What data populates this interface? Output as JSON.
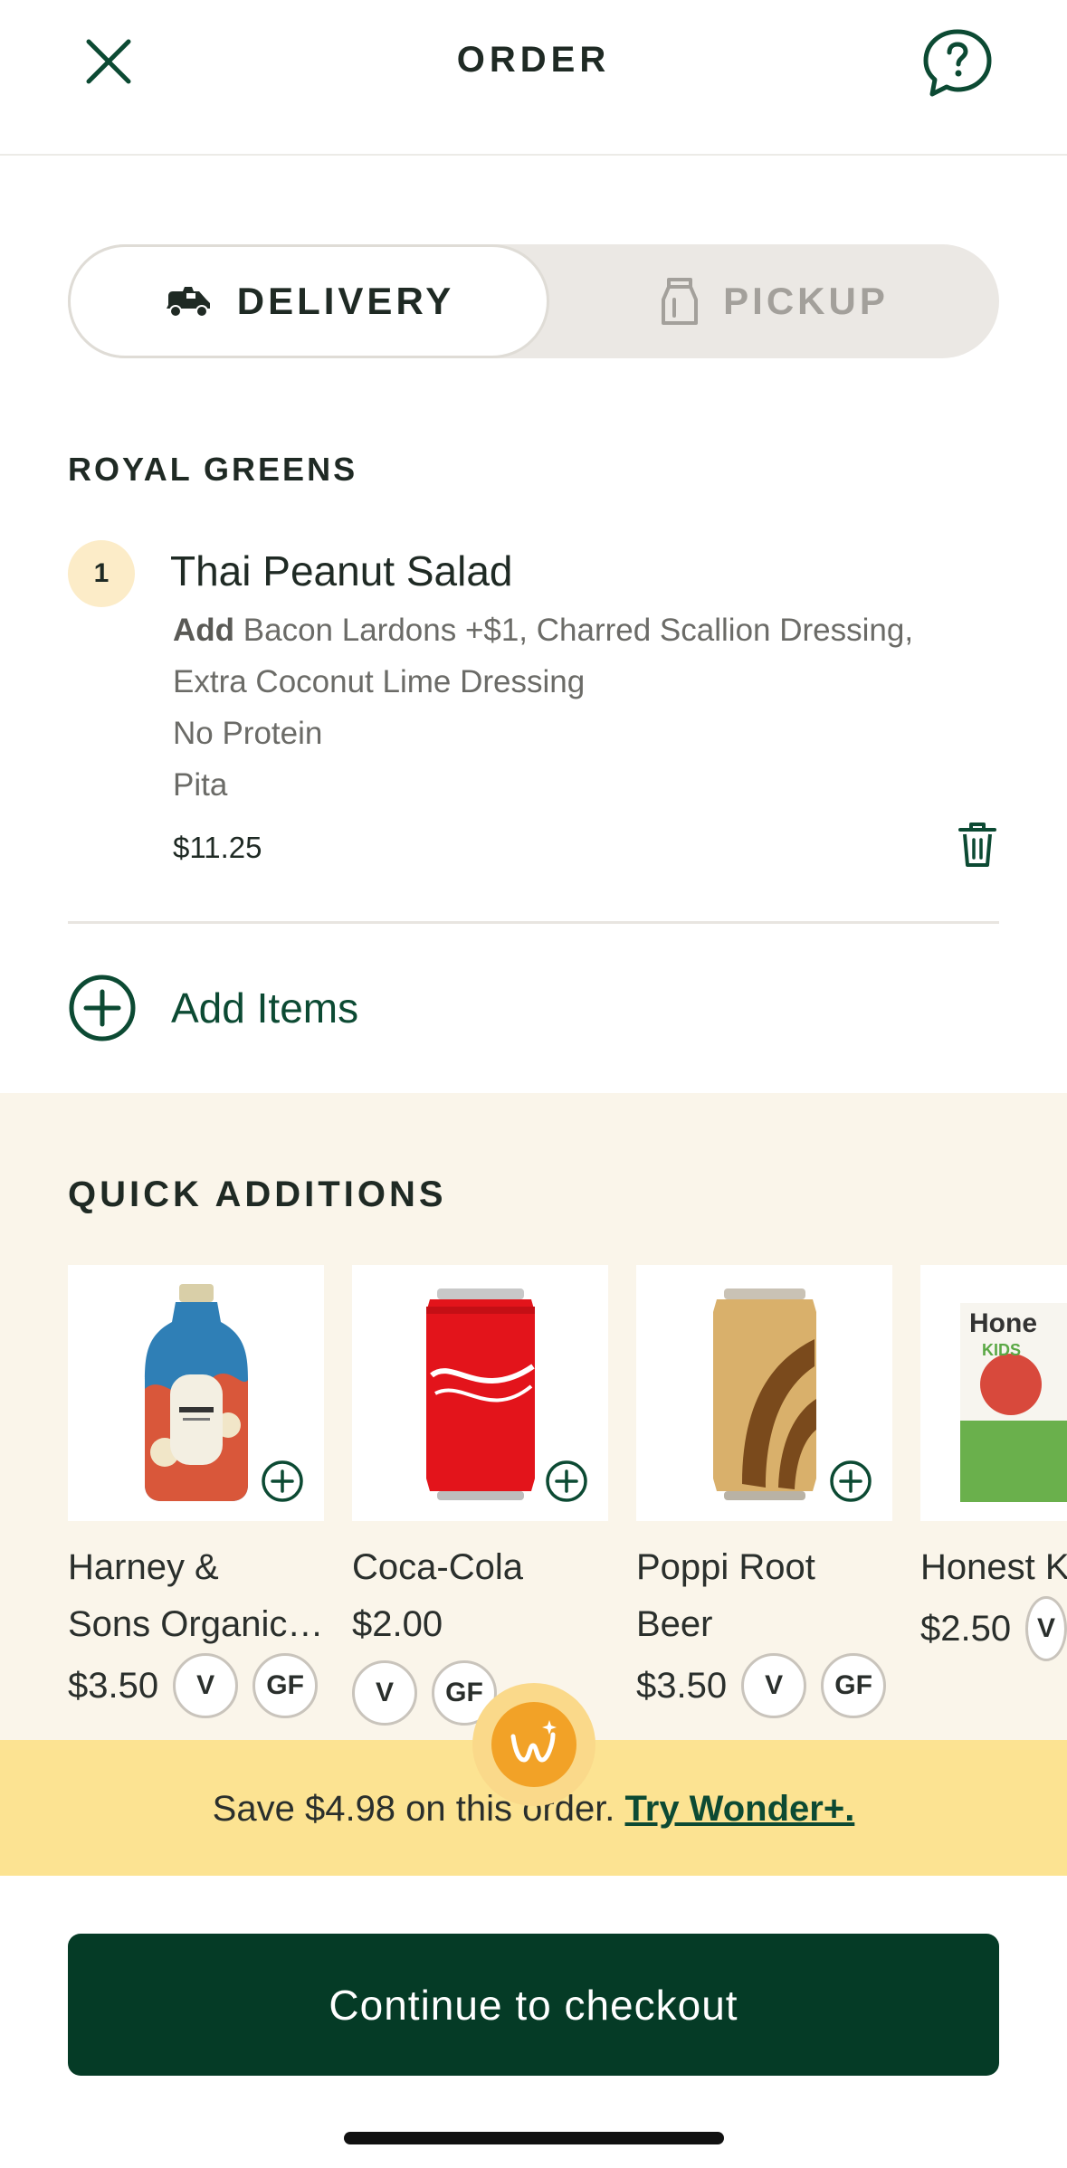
{
  "header": {
    "title": "ORDER",
    "close_icon": "close-icon",
    "help_icon": "help-chat-icon"
  },
  "mode_toggle": {
    "delivery_label": "DELIVERY",
    "pickup_label": "PICKUP",
    "selected": "delivery",
    "delivery_icon": "scooter-icon",
    "pickup_icon": "bag-icon"
  },
  "order": {
    "restaurant": "ROYAL GREENS",
    "items": [
      {
        "quantity": "1",
        "name": "Thai Peanut  Salad",
        "add_label": "Add",
        "add_text": " Bacon Lardons +$1, Charred Scallion Dressing, Extra Coconut Lime Dressing",
        "modifiers": [
          "No Protein",
          "Pita"
        ],
        "price": "$11.25"
      }
    ],
    "add_items_label": "Add Items"
  },
  "quick_additions": {
    "title": "QUICK ADDITIONS",
    "items": [
      {
        "name": "Harney & Sons Organic Black Tea",
        "price": "$3.50",
        "tags": [
          "V",
          "GF"
        ]
      },
      {
        "name": "Coca-Cola",
        "price": "$2.00",
        "tags": [
          "V",
          "GF"
        ]
      },
      {
        "name": "Poppi Root Beer",
        "price": "$3.50",
        "tags": [
          "V",
          "GF"
        ]
      },
      {
        "name": "Honest Kids Apple Juice",
        "price": "$2.50",
        "tags": [
          "V"
        ]
      }
    ]
  },
  "promo": {
    "text": "Save $4.98 on this order. ",
    "link": "Try Wonder+."
  },
  "cta": {
    "label": "Continue to checkout"
  },
  "colors": {
    "brand_green": "#053b26",
    "accent_green": "#0c4a33",
    "promo_yellow": "#fce392",
    "quick_bg": "#faf5ea",
    "badge_cream": "#fcecc8"
  }
}
